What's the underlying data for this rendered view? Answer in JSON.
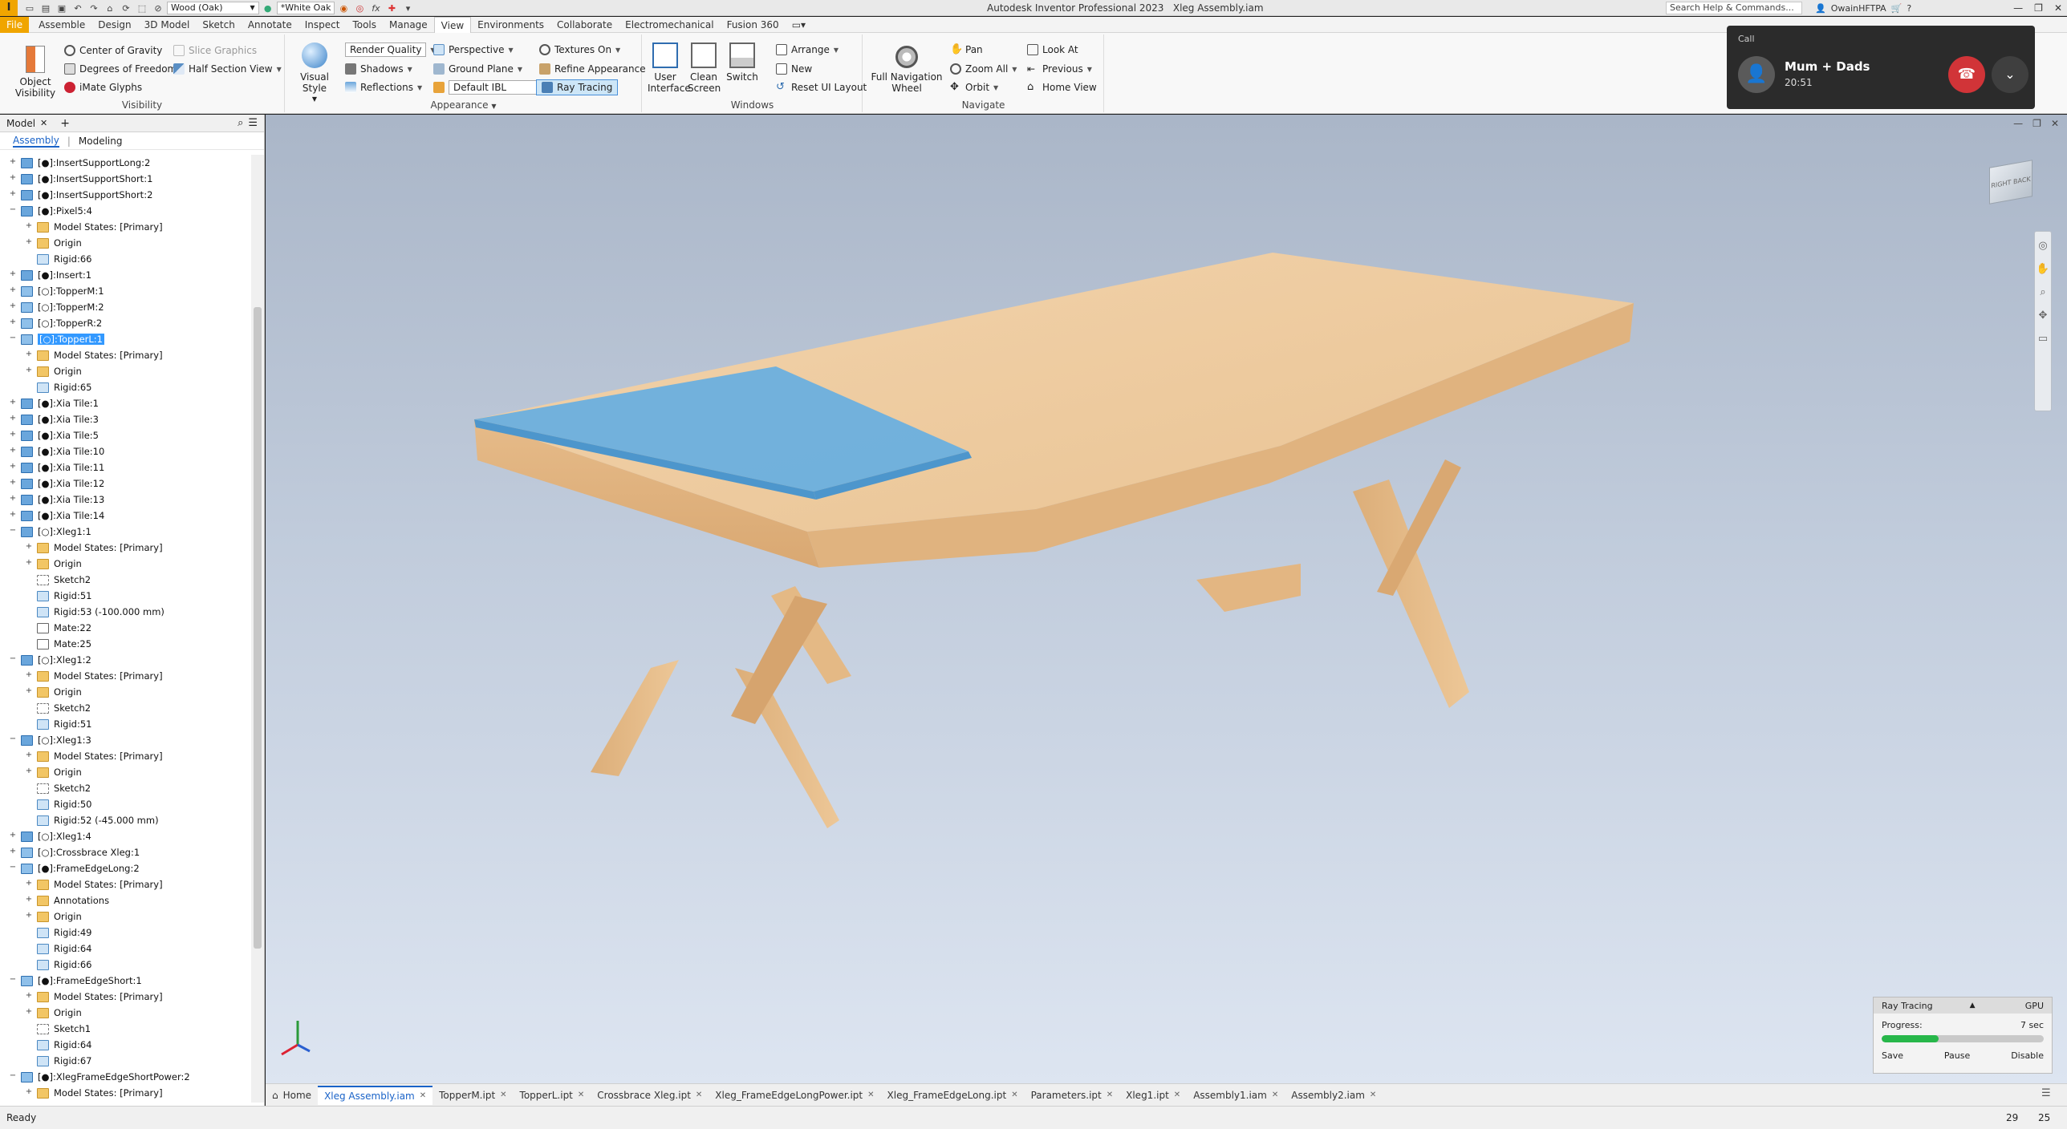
{
  "app": {
    "title": "Autodesk Inventor Professional 2023",
    "document": "Xleg Assembly.iam",
    "logo": "I"
  },
  "quick_access": {
    "material": "Wood (Oak)",
    "appearance": "*White Oak",
    "search_placeholder": "Search Help & Commands...",
    "user": "OwainHFTPA"
  },
  "ribbon_tabs": [
    "File",
    "Assemble",
    "Design",
    "3D Model",
    "Sketch",
    "Annotate",
    "Inspect",
    "Tools",
    "Manage",
    "View",
    "Environments",
    "Collaborate",
    "Electromechanical",
    "Fusion 360"
  ],
  "active_tab": "View",
  "ribbon": {
    "visibility": {
      "label": "Visibility",
      "object_visibility": "Object Visibility",
      "center_of_gravity": "Center of Gravity",
      "degrees_of_freedom": "Degrees of Freedom",
      "imate_glyphs": "iMate Glyphs",
      "slice_graphics": "Slice Graphics",
      "half_section_view": "Half Section View"
    },
    "appearance": {
      "label": "Appearance",
      "visual_style": "Visual Style",
      "render_quality": "Render Quality",
      "shadows": "Shadows",
      "reflections": "Reflections",
      "perspective": "Perspective",
      "ground_plane": "Ground Plane",
      "default_ibl": "Default IBL",
      "textures_on": "Textures On",
      "refine_appearance": "Refine Appearance",
      "ray_tracing": "Ray Tracing"
    },
    "windows": {
      "label": "Windows",
      "user_interface": "User Interface",
      "clean_screen": "Clean Screen",
      "switch": "Switch",
      "arrange": "Arrange",
      "new": "New",
      "reset_ui_layout": "Reset UI Layout"
    },
    "navigate": {
      "label": "Navigate",
      "full_navigation_wheel": "Full Navigation Wheel",
      "pan": "Pan",
      "zoom_all": "Zoom All",
      "orbit": "Orbit",
      "look_at": "Look At",
      "previous": "Previous",
      "home_view": "Home View"
    }
  },
  "browser": {
    "tab": "Model",
    "sub_tabs": [
      "Assembly",
      "Modeling"
    ],
    "rows": [
      {
        "indent": 0,
        "pm": "+",
        "icon": "asm",
        "text": "[●]:InsertSupportLong:2"
      },
      {
        "indent": 0,
        "pm": "+",
        "icon": "asm",
        "text": "[●]:InsertSupportShort:1"
      },
      {
        "indent": 0,
        "pm": "+",
        "icon": "asm",
        "text": "[●]:InsertSupportShort:2"
      },
      {
        "indent": 0,
        "pm": "−",
        "icon": "asm",
        "text": "[●]:Pixel5:4"
      },
      {
        "indent": 1,
        "pm": "+",
        "icon": "folder",
        "text": "Model States: [Primary]"
      },
      {
        "indent": 1,
        "pm": "+",
        "icon": "folder",
        "text": "Origin"
      },
      {
        "indent": 1,
        "pm": "",
        "icon": "rigid",
        "text": "Rigid:66"
      },
      {
        "indent": 0,
        "pm": "+",
        "icon": "asm",
        "text": "[●]:Insert:1"
      },
      {
        "indent": 0,
        "pm": "+",
        "icon": "part",
        "text": "[○]:TopperM:1"
      },
      {
        "indent": 0,
        "pm": "+",
        "icon": "part",
        "text": "[○]:TopperM:2"
      },
      {
        "indent": 0,
        "pm": "+",
        "icon": "part",
        "text": "[○]:TopperR:2"
      },
      {
        "indent": 0,
        "pm": "−",
        "icon": "part",
        "text": "[○]:TopperL:1",
        "selected": true
      },
      {
        "indent": 1,
        "pm": "+",
        "icon": "folder",
        "text": "Model States: [Primary]"
      },
      {
        "indent": 1,
        "pm": "+",
        "icon": "folder",
        "text": "Origin"
      },
      {
        "indent": 1,
        "pm": "",
        "icon": "rigid",
        "text": "Rigid:65"
      },
      {
        "indent": 0,
        "pm": "+",
        "icon": "asm",
        "text": "[●]:Xia Tile:1"
      },
      {
        "indent": 0,
        "pm": "+",
        "icon": "asm",
        "text": "[●]:Xia Tile:3"
      },
      {
        "indent": 0,
        "pm": "+",
        "icon": "asm",
        "text": "[●]:Xia Tile:5"
      },
      {
        "indent": 0,
        "pm": "+",
        "icon": "asm",
        "text": "[●]:Xia Tile:10"
      },
      {
        "indent": 0,
        "pm": "+",
        "icon": "asm",
        "text": "[●]:Xia Tile:11"
      },
      {
        "indent": 0,
        "pm": "+",
        "icon": "asm",
        "text": "[●]:Xia Tile:12"
      },
      {
        "indent": 0,
        "pm": "+",
        "icon": "asm",
        "text": "[●]:Xia Tile:13"
      },
      {
        "indent": 0,
        "pm": "+",
        "icon": "asm",
        "text": "[●]:Xia Tile:14"
      },
      {
        "indent": 0,
        "pm": "−",
        "icon": "asm",
        "text": "[○]:Xleg1:1"
      },
      {
        "indent": 1,
        "pm": "+",
        "icon": "folder",
        "text": "Model States: [Primary]"
      },
      {
        "indent": 1,
        "pm": "+",
        "icon": "folder",
        "text": "Origin"
      },
      {
        "indent": 1,
        "pm": "",
        "icon": "sketch",
        "text": "Sketch2"
      },
      {
        "indent": 1,
        "pm": "",
        "icon": "rigid",
        "text": "Rigid:51"
      },
      {
        "indent": 1,
        "pm": "",
        "icon": "rigid",
        "text": "Rigid:53 (-100.000 mm)"
      },
      {
        "indent": 1,
        "pm": "",
        "icon": "mate",
        "text": "Mate:22"
      },
      {
        "indent": 1,
        "pm": "",
        "icon": "mate",
        "text": "Mate:25"
      },
      {
        "indent": 0,
        "pm": "−",
        "icon": "asm",
        "text": "[○]:Xleg1:2"
      },
      {
        "indent": 1,
        "pm": "+",
        "icon": "folder",
        "text": "Model States: [Primary]"
      },
      {
        "indent": 1,
        "pm": "+",
        "icon": "folder",
        "text": "Origin"
      },
      {
        "indent": 1,
        "pm": "",
        "icon": "sketch",
        "text": "Sketch2"
      },
      {
        "indent": 1,
        "pm": "",
        "icon": "rigid",
        "text": "Rigid:51"
      },
      {
        "indent": 0,
        "pm": "−",
        "icon": "asm",
        "text": "[○]:Xleg1:3"
      },
      {
        "indent": 1,
        "pm": "+",
        "icon": "folder",
        "text": "Model States: [Primary]"
      },
      {
        "indent": 1,
        "pm": "+",
        "icon": "folder",
        "text": "Origin"
      },
      {
        "indent": 1,
        "pm": "",
        "icon": "sketch",
        "text": "Sketch2"
      },
      {
        "indent": 1,
        "pm": "",
        "icon": "rigid",
        "text": "Rigid:50"
      },
      {
        "indent": 1,
        "pm": "",
        "icon": "rigid",
        "text": "Rigid:52 (-45.000 mm)"
      },
      {
        "indent": 0,
        "pm": "+",
        "icon": "asm",
        "text": "[○]:Xleg1:4"
      },
      {
        "indent": 0,
        "pm": "+",
        "icon": "part",
        "text": "[○]:Crossbrace Xleg:1"
      },
      {
        "indent": 0,
        "pm": "−",
        "icon": "part",
        "text": "[●]:FrameEdgeLong:2"
      },
      {
        "indent": 1,
        "pm": "+",
        "icon": "folder",
        "text": "Model States: [Primary]"
      },
      {
        "indent": 1,
        "pm": "+",
        "icon": "folder",
        "text": "Annotations"
      },
      {
        "indent": 1,
        "pm": "+",
        "icon": "folder",
        "text": "Origin"
      },
      {
        "indent": 1,
        "pm": "",
        "icon": "rigid",
        "text": "Rigid:49"
      },
      {
        "indent": 1,
        "pm": "",
        "icon": "rigid",
        "text": "Rigid:64"
      },
      {
        "indent": 1,
        "pm": "",
        "icon": "rigid",
        "text": "Rigid:66"
      },
      {
        "indent": 0,
        "pm": "−",
        "icon": "part",
        "text": "[●]:FrameEdgeShort:1"
      },
      {
        "indent": 1,
        "pm": "+",
        "icon": "folder",
        "text": "Model States: [Primary]"
      },
      {
        "indent": 1,
        "pm": "+",
        "icon": "folder",
        "text": "Origin"
      },
      {
        "indent": 1,
        "pm": "",
        "icon": "sketch",
        "text": "Sketch1"
      },
      {
        "indent": 1,
        "pm": "",
        "icon": "rigid",
        "text": "Rigid:64"
      },
      {
        "indent": 1,
        "pm": "",
        "icon": "rigid",
        "text": "Rigid:67"
      },
      {
        "indent": 0,
        "pm": "−",
        "icon": "part",
        "text": "[●]:XlegFrameEdgeShortPower:2"
      },
      {
        "indent": 1,
        "pm": "+",
        "icon": "folder",
        "text": "Model States: [Primary]"
      }
    ]
  },
  "doc_tabs": [
    {
      "label": "Home",
      "closable": false,
      "active": false
    },
    {
      "label": "Xleg Assembly.iam",
      "closable": true,
      "active": true
    },
    {
      "label": "TopperM.ipt",
      "closable": true,
      "active": false
    },
    {
      "label": "TopperL.ipt",
      "closable": true,
      "active": false
    },
    {
      "label": "Crossbrace Xleg.ipt",
      "closable": true,
      "active": false
    },
    {
      "label": "Xleg_FrameEdgeLongPower.ipt",
      "closable": true,
      "active": false
    },
    {
      "label": "Xleg_FrameEdgeLong.ipt",
      "closable": true,
      "active": false
    },
    {
      "label": "Parameters.ipt",
      "closable": true,
      "active": false
    },
    {
      "label": "Xleg1.ipt",
      "closable": true,
      "active": false
    },
    {
      "label": "Assembly1.iam",
      "closable": true,
      "active": false
    },
    {
      "label": "Assembly2.iam",
      "closable": true,
      "active": false
    }
  ],
  "status": {
    "text": "Ready",
    "n1": "29",
    "n2": "25"
  },
  "call": {
    "header": "Call",
    "name": "Mum + Dads",
    "duration": "20:51"
  },
  "ray_tracing": {
    "title": "Ray Tracing",
    "gpu": "GPU",
    "progress_label": "Progress:",
    "time": "7 sec",
    "progress": 0.35,
    "save": "Save",
    "pause": "Pause",
    "disable": "Disable"
  },
  "viewcube": {
    "right": "RIGHT",
    "back": "BACK"
  },
  "colors": {
    "accent": "#f0a500",
    "selection": "#3399ff",
    "wood": "#ecc79b",
    "highlight": "#6aafdf",
    "progress": "#27b74a",
    "hangup": "#d13438"
  }
}
